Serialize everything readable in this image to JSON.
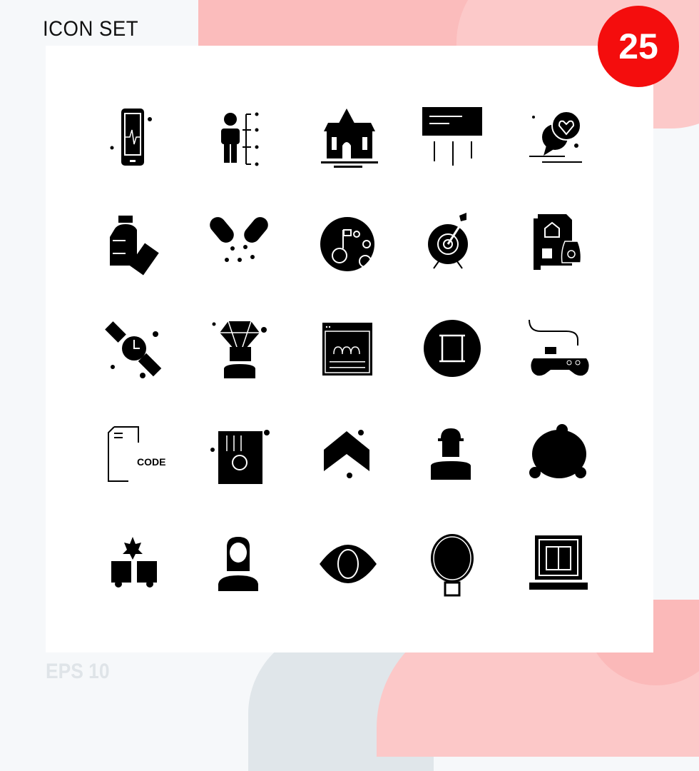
{
  "header": {
    "title": "ICON SET"
  },
  "badge": {
    "count": "25",
    "color": "#f40d0d"
  },
  "footer": {
    "label": "EPS 10"
  },
  "colors": {
    "icon": "#000000",
    "card": "#ffffff",
    "accent_bg": "#fbbcbc"
  },
  "icons": [
    {
      "name": "mobile-heartbeat-icon"
    },
    {
      "name": "person-height-icon"
    },
    {
      "name": "house-icon"
    },
    {
      "name": "billboard-icon"
    },
    {
      "name": "love-chat-icon"
    },
    {
      "name": "medicine-bottle-pills-icon"
    },
    {
      "name": "capsule-icon"
    },
    {
      "name": "moon-flag-icon"
    },
    {
      "name": "target-arrow-icon"
    },
    {
      "name": "property-document-money-icon"
    },
    {
      "name": "wrist-watch-icon"
    },
    {
      "name": "diamond-head-icon"
    },
    {
      "name": "web-group-icon"
    },
    {
      "name": "circle-frame-icon"
    },
    {
      "name": "gamepad-icon"
    },
    {
      "name": "code-file-icon"
    },
    {
      "name": "document-settings-icon"
    },
    {
      "name": "arrow-up-icon"
    },
    {
      "name": "engineer-icon"
    },
    {
      "name": "bun-icon"
    },
    {
      "name": "car-crash-icon"
    },
    {
      "name": "woman-avatar-icon"
    },
    {
      "name": "eye-icon"
    },
    {
      "name": "petri-dish-icon"
    },
    {
      "name": "laptop-window-icon"
    }
  ],
  "code_icon_text": "CODE"
}
